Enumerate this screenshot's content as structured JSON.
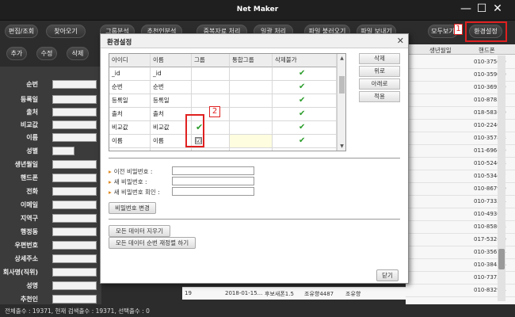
{
  "window": {
    "title": "Net Maker",
    "minimize": "—",
    "maximize": "☐",
    "close": "✕"
  },
  "toolbar": {
    "buttons": [
      "편집/조회",
      "찾아오기",
      "그룹분석",
      "추천인분석",
      "중복자료 처리",
      "일괄 처리",
      "파일 불러오기",
      "파일 보내기"
    ],
    "show_all": "모두보기",
    "settings": "환경설정"
  },
  "toolbar2": {
    "add": "추가",
    "edit": "수정",
    "delete": "삭제"
  },
  "sidebar": {
    "fields": [
      "순번",
      "등록일",
      "출처",
      "비교값",
      "이름",
      "성별",
      "생년월일",
      "핸드폰",
      "전화",
      "이메일",
      "지역구",
      "행정동",
      "우편번호",
      "상세주소",
      "회사명(직위)",
      "성명",
      "추천인"
    ]
  },
  "grid": {
    "headers": {
      "birth": "생년월일",
      "phone": "핸드폰"
    },
    "phones": [
      "010-3756-9",
      "010-3590-0",
      "010-3693-9",
      "010-8785-7",
      "018-583-60",
      "010-2240-2",
      "010-3578-8",
      "011-696-19",
      "010-5240-8",
      "010-5344-7",
      "010-8679-0",
      "010-7333-4",
      "010-4936-5",
      "010-8586-8",
      "017-532-70",
      "010-3567-4",
      "010-3845-6",
      "010-7373-7",
      "010-8329-4"
    ],
    "bottom_row": {
      "no": "19",
      "date": "2018-01-15...",
      "source": "후보새폰1.5",
      "compare": "조유향4487",
      "name": "조유향"
    }
  },
  "status": {
    "text": "전체출수 : 19371, 현재 검색출수 : 19371, 선택출수 : 0"
  },
  "markers": {
    "one": "1",
    "two": "2"
  },
  "dialog": {
    "title": "환경설정",
    "close": "✕",
    "table": {
      "headers": [
        "아이디",
        "이름",
        "그룹",
        "통합그룹",
        "삭제불가"
      ],
      "rows": [
        {
          "id": "_id",
          "name": "_id",
          "group": "",
          "delete_lock": "✔"
        },
        {
          "id": "순번",
          "name": "순번",
          "group": "",
          "delete_lock": "✔"
        },
        {
          "id": "등록일",
          "name": "등록일",
          "group": "",
          "delete_lock": "✔"
        },
        {
          "id": "출처",
          "name": "출처",
          "group": "",
          "delete_lock": "✔"
        },
        {
          "id": "비교값",
          "name": "비교값",
          "group": "✔",
          "delete_lock": "✔"
        },
        {
          "id": "이름",
          "name": "이름",
          "group": "☑",
          "delete_lock": "✔"
        },
        {
          "id": "성별",
          "name": "성별",
          "group": "",
          "delete_lock": ""
        }
      ]
    },
    "side_buttons": [
      "삭제",
      "위로",
      "아래로",
      "적용"
    ],
    "password": {
      "current_label": "이전 비밀번호 :",
      "new_label": "새 비밀번호 :",
      "confirm_label": "새 비밀번호 회인 :",
      "change_button": "비밀번호 변경"
    },
    "data_buttons": {
      "clear_all": "모든 데이터 지우기",
      "reorder": "모든 데이터 순번 재정렬 하기"
    },
    "close_button": "닫기"
  },
  "colors": {
    "highlight": "#e02020",
    "check": "#2a9d2a"
  }
}
